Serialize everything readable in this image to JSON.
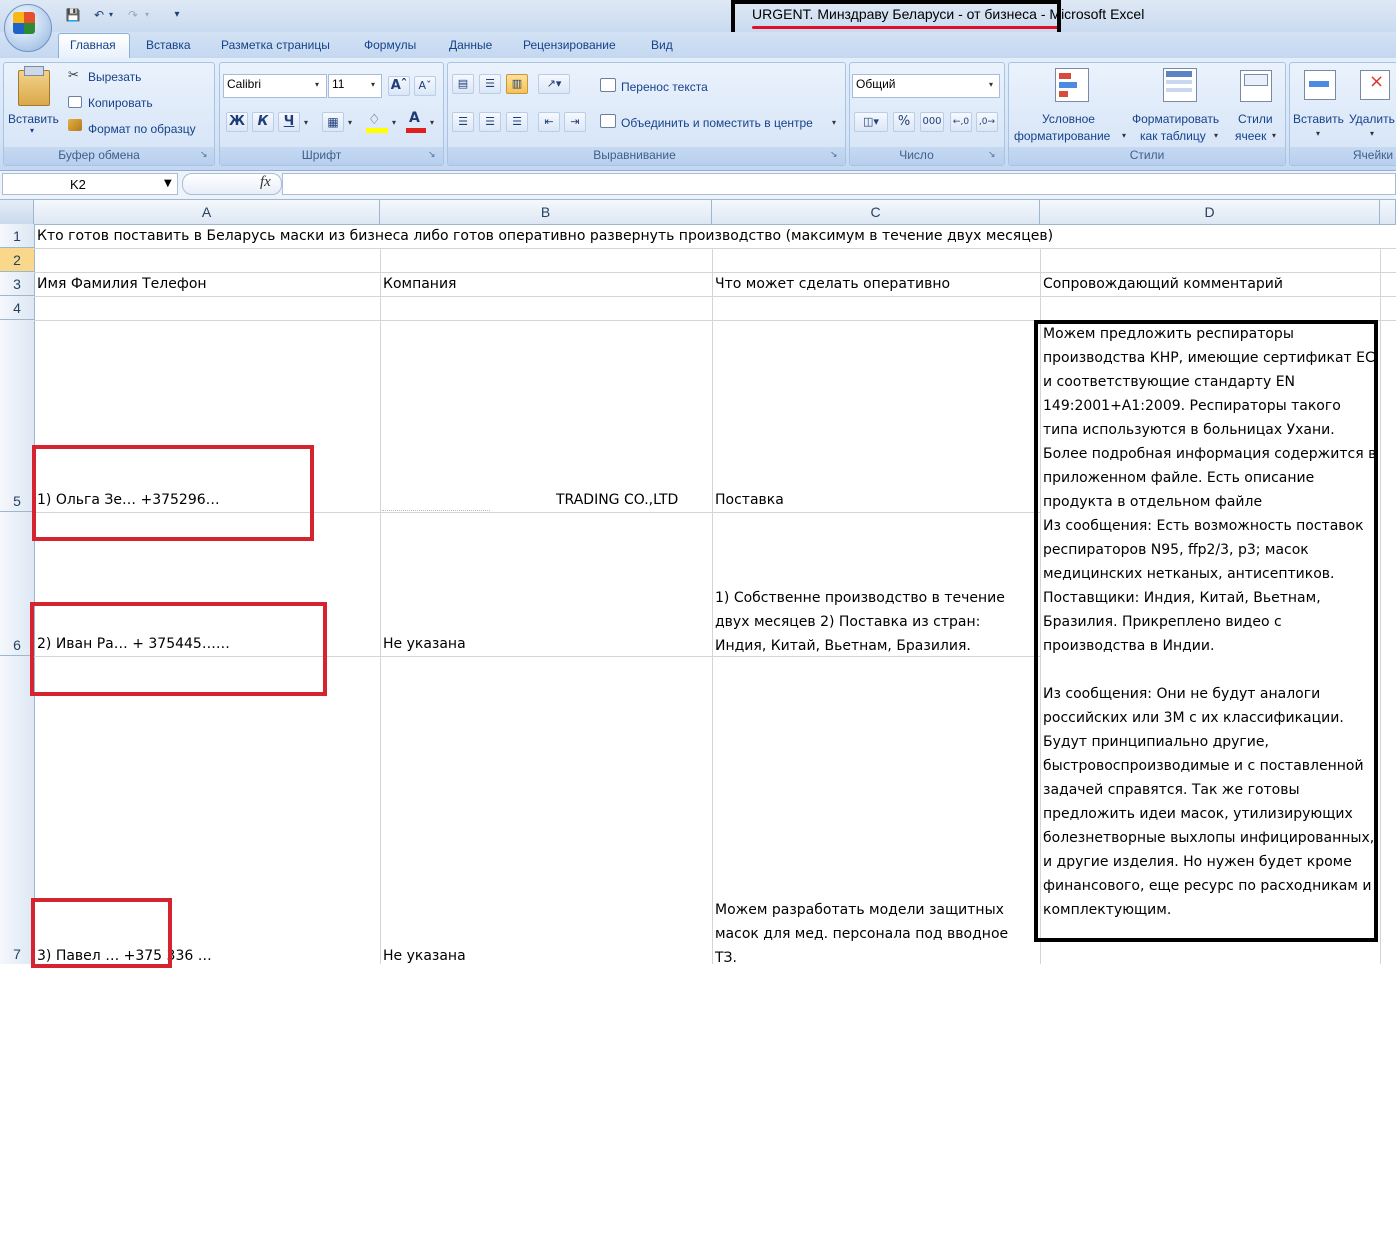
{
  "window": {
    "title": "URGENT. Минздраву Беларуси - от бизнеса - Microsoft Excel"
  },
  "quick_access": [
    "save-icon",
    "undo-icon",
    "redo-icon",
    "customize-icon"
  ],
  "tabs": [
    "Главная",
    "Вставка",
    "Разметка страницы",
    "Формулы",
    "Данные",
    "Рецензирование",
    "Вид"
  ],
  "active_tab": "Главная",
  "ribbon": {
    "clipboard": {
      "paste": "Вставить",
      "cut": "Вырезать",
      "copy": "Копировать",
      "format_painter": "Формат по образцу",
      "group": "Буфер обмена"
    },
    "font": {
      "name": "Calibri",
      "size": "11",
      "bold": "Ж",
      "italic": "К",
      "underline": "Ч",
      "group": "Шрифт"
    },
    "alignment": {
      "wrap_text": "Перенос текста",
      "merge_center": "Объединить и поместить в центре",
      "group": "Выравнивание"
    },
    "number": {
      "format": "Общий",
      "percent": "%",
      "thousands": "000",
      "group": "Число"
    },
    "styles": {
      "conditional_1": "Условное",
      "conditional_2": "форматирование",
      "as_table_1": "Форматировать",
      "as_table_2": "как таблицу",
      "cell_styles_1": "Стили",
      "cell_styles_2": "ячеек",
      "group": "Стили"
    },
    "cells": {
      "insert": "Вставить",
      "delete": "Удалить",
      "group": "Ячейки"
    }
  },
  "formula_bar": {
    "name_box": "K2",
    "fx": "fx",
    "value": ""
  },
  "sheet": {
    "columns": [
      "A",
      "B",
      "C",
      "D"
    ],
    "rows": [
      "1",
      "2",
      "3",
      "4",
      "5",
      "6",
      "7"
    ],
    "r1_a": "Кто готов поставить в Беларусь маски из бизнеса либо готов оперативно развернуть производство (максимум в течение двух месяцев)",
    "r3_a": "Имя Фамилия Телефон",
    "r3_b": "Компания",
    "r3_c": "Что может сделать оперативно",
    "r3_d": "Сопровождающий комментарий",
    "r5_a": "1) Ольга Зе… +375296…",
    "r5_b": "TRADING CO.,LTD",
    "r5_c": "Поставка",
    "r6_a": "2) Иван Ра… + 375445……",
    "r6_b": "Не указана",
    "r6_c": "1) Собственне производство в течение двух месяцев 2) Поставка из стран: Индия, Китай, Вьетнам, Бразилия.",
    "r7_a": "3) Павел … +375 336 …",
    "r7_b": "Не указана",
    "r7_c": "Можем разработать модели защитных масок для мед. персонала под вводное ТЗ.",
    "d_comment_1": "Можем предложить респираторы производства КНР, имеющие сертификат ЕС и соответствующие стандарту EN 149:2001+A1:2009. Респираторы такого типа используются в больницах Ухани. Более подробная информация содержится в приложенном файле. Есть описание продукта в отдельном файле",
    "d_comment_2": "Из сообщения: Есть возможность поставок респираторов N95, ffp2/3, p3; масок медицинских нетканых, антисептиков. Поставщики: Индия, Китай, Вьетнам, Бразилия. Прикреплено видео с производства в Индии.",
    "d_comment_3": "Из сообщения: Они не будут аналоги российских или 3М с их классификации. Будут принципиально другие, быстровоспроизводимые и с поставленной задачей справятся. Так же готовы предложить идеи масок, утилизирующих болезнетворные выхлопы инфицированных, и другие изделия. Но нужен будет кроме финансового, еще ресурс по расходникам и комплектующим."
  },
  "annotations": {
    "red_box_color": "#d3242f",
    "black_box_color": "#000000"
  }
}
